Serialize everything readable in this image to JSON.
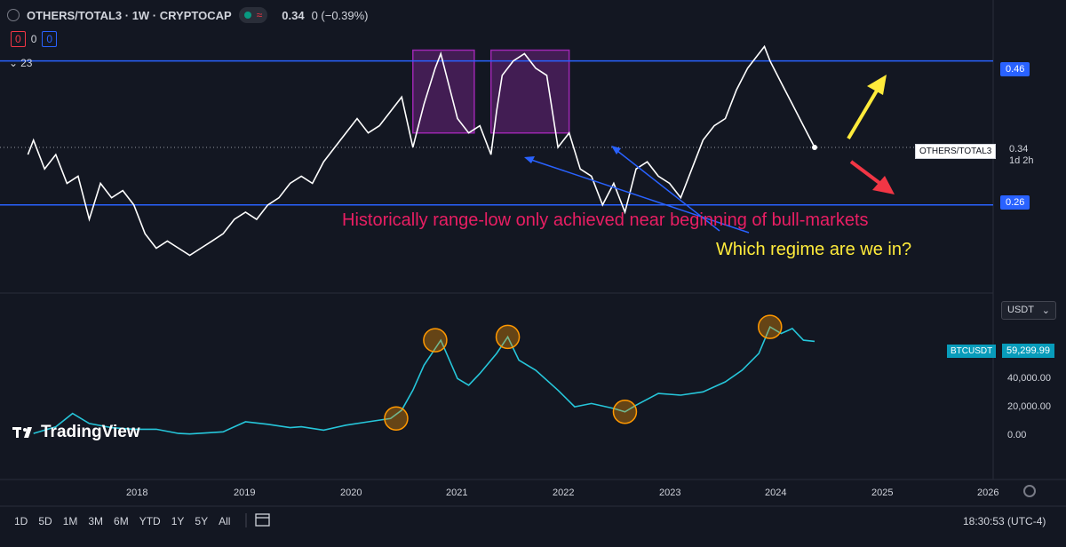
{
  "header": {
    "title": "OTHERS/TOTAL3 · 1W · CRYPTOCAP",
    "wave_icon": "wave-icon",
    "price": "0.34",
    "change": "0 (−0.39%)"
  },
  "counters": {
    "left": "0",
    "mid": "0",
    "right": "0"
  },
  "collapse_label": "23",
  "main_pane": {
    "hline_upper_label": "0.46",
    "hline_lower_label": "0.26",
    "symbol_label": "OTHERS/TOTAL3",
    "symbol_value": "0.34",
    "symbol_countdown": "1d 2h",
    "annotation_pink": "Historically range-low only achieved near beginning of bull-markets",
    "annotation_yellow": "Which regime are we in?"
  },
  "lower_pane": {
    "currency_select": "USDT",
    "symbol_label": "BTCUSDT",
    "symbol_value": "59,299.99",
    "y_ticks": [
      "40,000.00",
      "20,000.00",
      "0.00"
    ]
  },
  "watermark": "TradingView",
  "x_axis": [
    "2018",
    "2019",
    "2020",
    "2021",
    "2022",
    "2023",
    "2024",
    "2025",
    "2026"
  ],
  "bottom_bar": {
    "ranges": [
      "1D",
      "5D",
      "1M",
      "3M",
      "6M",
      "YTD",
      "1Y",
      "5Y",
      "All"
    ],
    "clock": "18:30:53 (UTC-4)"
  },
  "colors": {
    "background": "#131722",
    "hline": "#2962ff",
    "main_line": "#ffffff",
    "btc_line": "#26c6da",
    "rect": "#9c27b0",
    "circle": "#ff9800",
    "pink": "#e91e63",
    "yellow": "#ffeb3b",
    "red": "#f23645"
  },
  "chart_data": [
    {
      "type": "line",
      "series": [
        {
          "name": "OTHERS/TOTAL3",
          "x": [
            2017.55,
            2017.6,
            2017.7,
            2017.8,
            2017.9,
            2018.0,
            2018.1,
            2018.2,
            2018.3,
            2018.4,
            2018.5,
            2018.6,
            2018.7,
            2018.8,
            2018.9,
            2019.0,
            2019.1,
            2019.2,
            2019.3,
            2019.4,
            2019.5,
            2019.6,
            2019.7,
            2019.8,
            2019.9,
            2020.0,
            2020.1,
            2020.2,
            2020.3,
            2020.4,
            2020.5,
            2020.6,
            2020.7,
            2020.8,
            2020.9,
            2021.0,
            2021.1,
            2021.2,
            2021.25,
            2021.3,
            2021.4,
            2021.5,
            2021.6,
            2021.7,
            2021.75,
            2021.8,
            2021.9,
            2022.0,
            2022.1,
            2022.2,
            2022.3,
            2022.4,
            2022.5,
            2022.6,
            2022.7,
            2022.8,
            2022.9,
            2023.0,
            2023.1,
            2023.2,
            2023.3,
            2023.4,
            2023.5,
            2023.6,
            2023.7,
            2023.8,
            2023.9,
            2024.0,
            2024.1,
            2024.15,
            2024.2,
            2024.3,
            2024.4,
            2024.5,
            2024.6
          ],
          "values": [
            0.33,
            0.35,
            0.31,
            0.33,
            0.29,
            0.3,
            0.24,
            0.29,
            0.27,
            0.28,
            0.26,
            0.22,
            0.2,
            0.21,
            0.2,
            0.19,
            0.2,
            0.21,
            0.22,
            0.24,
            0.25,
            0.24,
            0.26,
            0.27,
            0.29,
            0.3,
            0.29,
            0.32,
            0.34,
            0.36,
            0.38,
            0.36,
            0.37,
            0.39,
            0.41,
            0.34,
            0.4,
            0.45,
            0.47,
            0.44,
            0.38,
            0.36,
            0.37,
            0.33,
            0.39,
            0.44,
            0.46,
            0.47,
            0.45,
            0.44,
            0.34,
            0.36,
            0.31,
            0.3,
            0.26,
            0.29,
            0.25,
            0.31,
            0.32,
            0.3,
            0.29,
            0.27,
            0.31,
            0.35,
            0.37,
            0.38,
            0.42,
            0.45,
            0.47,
            0.48,
            0.46,
            0.43,
            0.4,
            0.37,
            0.34
          ]
        }
      ],
      "hlines": [
        0.46,
        0.26
      ],
      "highlight_boxes": [
        [
          2021.0,
          2021.55
        ],
        [
          2021.7,
          2022.4
        ]
      ],
      "ylim": [
        0.15,
        0.52
      ],
      "xlim": [
        2017.3,
        2026.2
      ],
      "title": ""
    },
    {
      "type": "line",
      "series": [
        {
          "name": "BTCUSDT",
          "x": [
            2017.6,
            2017.8,
            2017.95,
            2018.1,
            2018.3,
            2018.5,
            2018.7,
            2018.9,
            2019.0,
            2019.3,
            2019.5,
            2019.7,
            2019.9,
            2020.0,
            2020.2,
            2020.4,
            2020.6,
            2020.8,
            2020.9,
            2021.0,
            2021.1,
            2021.25,
            2021.4,
            2021.5,
            2021.6,
            2021.75,
            2021.85,
            2021.95,
            2022.1,
            2022.3,
            2022.45,
            2022.6,
            2022.8,
            2022.9,
            2023.0,
            2023.2,
            2023.4,
            2023.6,
            2023.8,
            2023.95,
            2024.1,
            2024.2,
            2024.3,
            2024.4,
            2024.5,
            2024.6
          ],
          "values": [
            4000,
            8000,
            16000,
            10000,
            7500,
            6500,
            6500,
            4000,
            3700,
            5000,
            11000,
            9500,
            7500,
            8000,
            6000,
            9000,
            11000,
            13000,
            18000,
            30000,
            45000,
            60000,
            37000,
            33000,
            40000,
            52000,
            62000,
            48000,
            42000,
            30000,
            20000,
            22000,
            19000,
            17000,
            21000,
            28000,
            27000,
            29000,
            35000,
            42000,
            52000,
            68000,
            64000,
            67000,
            60000,
            59300
          ]
        }
      ],
      "highlight_circles": [
        2020.85,
        2021.2,
        2021.85,
        2022.9,
        2024.2
      ],
      "ylim": [
        -5000,
        75000
      ],
      "xlim": [
        2017.3,
        2026.2
      ],
      "title": ""
    }
  ]
}
